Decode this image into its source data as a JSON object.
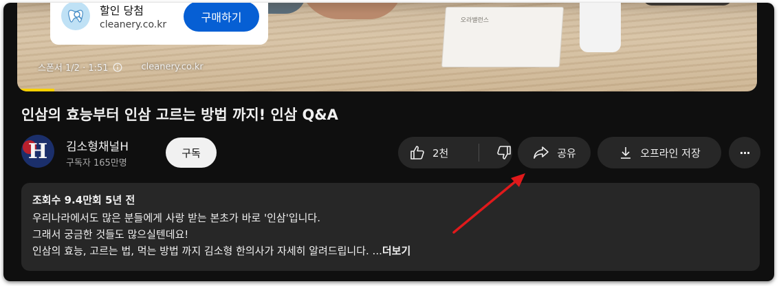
{
  "ad": {
    "title": "할인 당첨",
    "domain": "cleanery.co.kr",
    "cta_label": "구매하기",
    "sponsor_label": "스폰서 1/2 · 1:51",
    "sponsor_domain": "cleanery.co.kr"
  },
  "video": {
    "product_box_text": "오라밸런스",
    "progress": 0.05,
    "title": "인삼의 효능부터 인삼 고르는 방법 까지! 인삼 Q&A"
  },
  "channel": {
    "avatar_letter": "H",
    "name": "김소형채널H",
    "subscribers": "구독자 165만명",
    "subscribe_label": "구독"
  },
  "actions": {
    "like_count": "2천",
    "share_label": "공유",
    "download_label": "오프라인 저장",
    "more_label": "···"
  },
  "description": {
    "meta": "조회수 9.4만회  5년 전",
    "lines": [
      "우리나라에서도 많은 분들에게 사랑 받는 본초가 바로 '인삼'입니다.",
      "그래서 궁금한 것들도 많으실텐데요!",
      "인삼의 효능, 고르는 법, 먹는 방법 까지 김소형 한의사가 자세히 알려드립니다. ..."
    ],
    "more_label": "더보기"
  },
  "annotation": {
    "arrow_color": "#e0191b"
  },
  "colors": {
    "background": "#0f0f0f",
    "pill": "#272727",
    "accent_blue": "#065fd4",
    "text": "#f1f1f1",
    "secondary_text": "#aaaaaa"
  }
}
